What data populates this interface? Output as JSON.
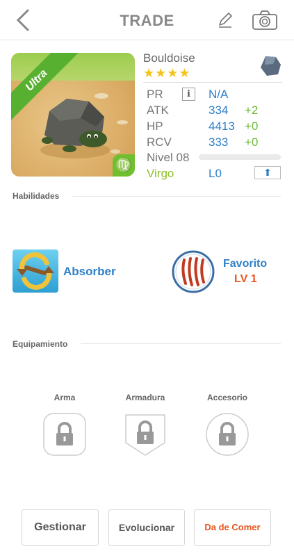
{
  "header": {
    "title": "TRADE",
    "back_icon": "chevron-left-icon",
    "edit_icon": "pencil-icon",
    "camera_icon": "camera-icon"
  },
  "card": {
    "rarity": "Ultra",
    "zodiac_symbol": "♍",
    "colors": {
      "ribbon": "#58b030",
      "zodiac_badge": "#6fbf2f"
    }
  },
  "monster": {
    "name": "Bouldoise",
    "stars": "★★★★",
    "element_icon": "rock-element-icon"
  },
  "stats": {
    "pr": {
      "label": "PR",
      "value": "N/A"
    },
    "atk": {
      "label": "ATK",
      "value": "334",
      "bonus": "+2"
    },
    "hp": {
      "label": "HP",
      "value": "4413",
      "bonus": "+0"
    },
    "rcv": {
      "label": "RCV",
      "value": "333",
      "bonus": "+0"
    },
    "level": {
      "label": "Nivel 08",
      "progress": 0
    },
    "sign": {
      "label": "Virgo",
      "value": "L0"
    }
  },
  "sections": {
    "abilities": "Habilidades",
    "equipment": "Equipamiento"
  },
  "abilities": {
    "skill": {
      "name": "Absorber",
      "icon": "absorb-swap-icon"
    },
    "leader": {
      "name": "Favorito",
      "level": "LV 1",
      "icon": "claw-scratch-icon"
    }
  },
  "equipment": [
    {
      "label": "Arma",
      "icon": "lock-icon"
    },
    {
      "label": "Armadura",
      "icon": "lock-icon"
    },
    {
      "label": "Accesorio",
      "icon": "lock-icon"
    }
  ],
  "buttons": {
    "manage": "Gestionar",
    "evolve": "Evolucionar",
    "feed": "Da de Comer"
  },
  "colors": {
    "stat_value": "#2f7fc8",
    "stat_bonus": "#6ab934",
    "accent_orange": "#e5561e",
    "star": "#f3c31e"
  }
}
